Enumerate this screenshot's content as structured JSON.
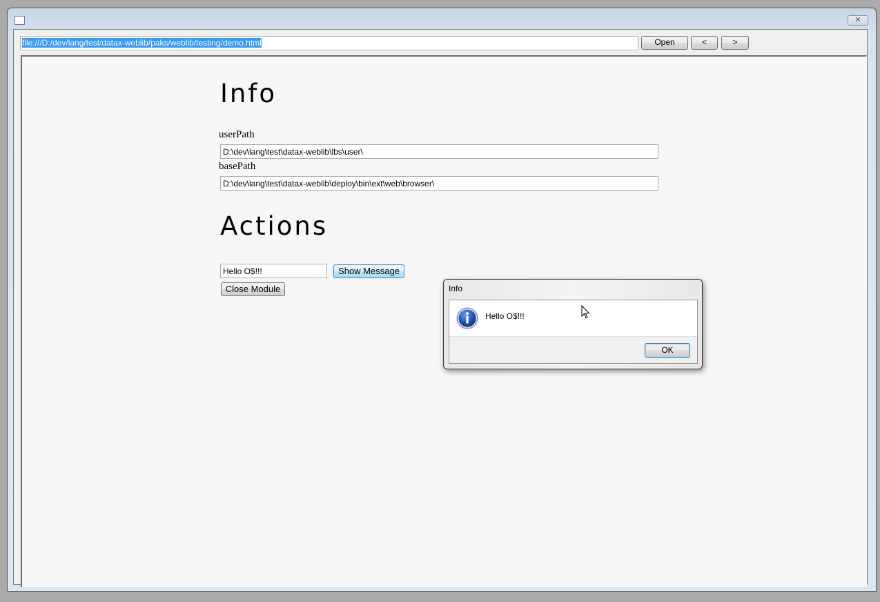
{
  "window": {
    "title": "",
    "close_label": "✕"
  },
  "toolbar": {
    "url": "file:///D:/dev/lang/test/datax-weblib/paks/weblib/testing/demo.html",
    "open_label": "Open",
    "back_label": "<",
    "forward_label": ">"
  },
  "page": {
    "info_heading": "Info",
    "user_path_label": "userPath",
    "user_path_value": "D:\\dev\\lang\\test\\datax-weblib\\lbs\\user\\",
    "base_path_label": "basePath",
    "base_path_value": "D:\\dev\\lang\\test\\datax-weblib\\deploy\\bin\\ext\\web\\browser\\",
    "actions_heading": "Actions",
    "message_input_value": "Hello O$!!!",
    "show_message_label": "Show Message",
    "close_module_label": "Close Module"
  },
  "dialog": {
    "title": "Info",
    "icon": "info-icon",
    "message": "Hello O$!!!",
    "ok_label": "OK"
  },
  "colors": {
    "selection": "#3399ff",
    "page_background": "#f7f7f7",
    "info_icon_blue": "#1f4fb5"
  }
}
